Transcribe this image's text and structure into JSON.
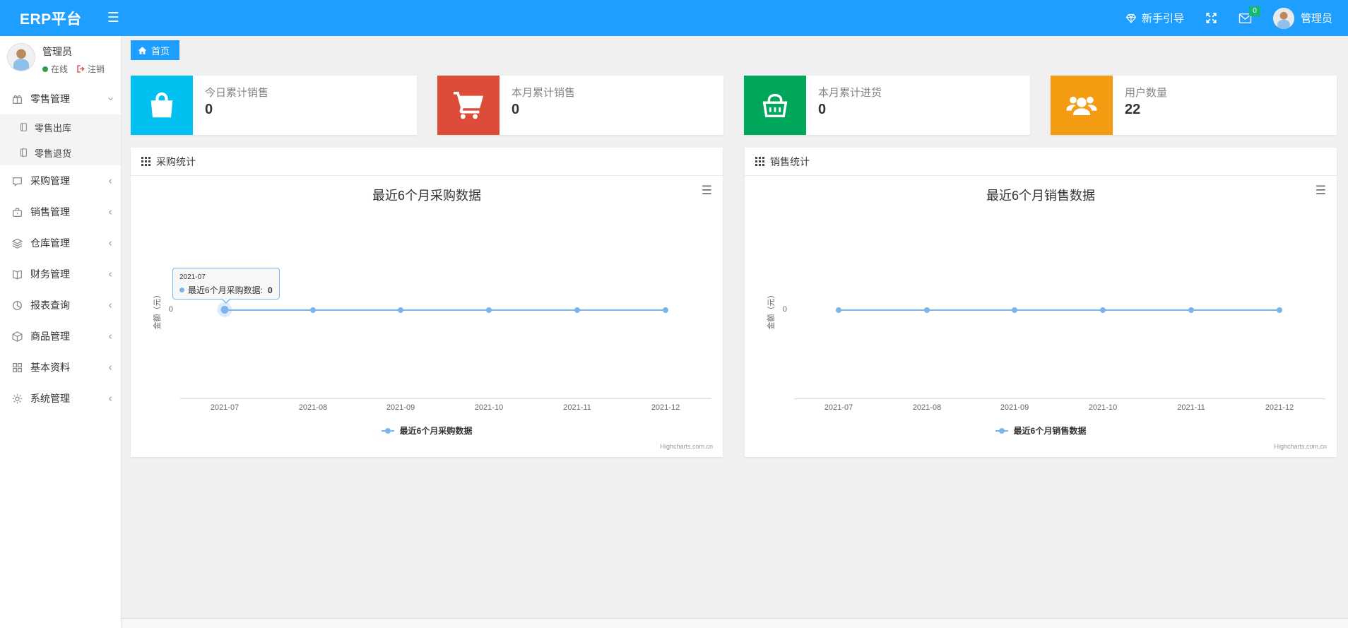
{
  "navbar": {
    "brand": "ERP平台",
    "guide_label": "新手引导",
    "message_badge": "0",
    "user_name": "管理员"
  },
  "sidebar": {
    "user": {
      "name": "管理员",
      "status": "在线",
      "logout": "注销"
    },
    "menu": [
      {
        "label": "零售管理",
        "icon": "gift-icon",
        "state": "expanded"
      },
      {
        "label": "零售出库",
        "icon": "notebook-icon"
      },
      {
        "label": "零售退货",
        "icon": "notebook-icon"
      },
      {
        "label": "采购管理",
        "icon": "chat-icon",
        "state": "collapsed"
      },
      {
        "label": "销售管理",
        "icon": "briefcase-icon",
        "state": "collapsed"
      },
      {
        "label": "仓库管理",
        "icon": "layers-icon",
        "state": "collapsed"
      },
      {
        "label": "财务管理",
        "icon": "open-book-icon",
        "state": "collapsed"
      },
      {
        "label": "报表查询",
        "icon": "pie-chart-icon",
        "state": "collapsed"
      },
      {
        "label": "商品管理",
        "icon": "package-icon",
        "state": "collapsed"
      },
      {
        "label": "基本资料",
        "icon": "grid-icon",
        "state": "collapsed"
      },
      {
        "label": "系统管理",
        "icon": "gear-icon",
        "state": "collapsed"
      }
    ]
  },
  "breadcrumb": {
    "home": "首页"
  },
  "stat_cards": [
    {
      "label": "今日累计销售",
      "value": "0",
      "icon": "shopping-bag-icon",
      "color": "#00c0ef"
    },
    {
      "label": "本月累计销售",
      "value": "0",
      "icon": "shopping-cart-icon",
      "color": "#dd4b39"
    },
    {
      "label": "本月累计进货",
      "value": "0",
      "icon": "shopping-basket-icon",
      "color": "#00a65a"
    },
    {
      "label": "用户数量",
      "value": "22",
      "icon": "users-icon",
      "color": "#f39c12"
    }
  ],
  "panels": [
    {
      "title": "采购统计"
    },
    {
      "title": "销售统计"
    }
  ],
  "chart_data": [
    {
      "type": "line",
      "title": "最近6个月采购数据",
      "categories": [
        "2021-07",
        "2021-08",
        "2021-09",
        "2021-10",
        "2021-11",
        "2021-12"
      ],
      "series": [
        {
          "name": "最近6个月采购数据",
          "values": [
            0,
            0,
            0,
            0,
            0,
            0
          ]
        }
      ],
      "xlabel": "",
      "ylabel": "金额（元）",
      "ytick": "0",
      "ylim": [
        0,
        0
      ],
      "grid": false,
      "legend_position": "bottom",
      "line_color": "#7cb5ec",
      "credit": "Highcharts.com.cn",
      "tooltip": {
        "header": "2021-07",
        "label": "最近6个月采购数据:",
        "value": "0"
      }
    },
    {
      "type": "line",
      "title": "最近6个月销售数据",
      "categories": [
        "2021-07",
        "2021-08",
        "2021-09",
        "2021-10",
        "2021-11",
        "2021-12"
      ],
      "series": [
        {
          "name": "最近6个月销售数据",
          "values": [
            0,
            0,
            0,
            0,
            0,
            0
          ]
        }
      ],
      "xlabel": "",
      "ylabel": "金额（元）",
      "ytick": "0",
      "ylim": [
        0,
        0
      ],
      "grid": false,
      "legend_position": "bottom",
      "line_color": "#7cb5ec",
      "credit": "Highcharts.com.cn"
    }
  ],
  "theme": {
    "navbar_blue": "#1E9FFF",
    "badge_green": "#16b777",
    "card_cyan": "#00c0ef",
    "card_red": "#dd4b39",
    "card_green": "#00a65a",
    "card_orange": "#f39c12",
    "chart_line": "#7cb5ec"
  }
}
